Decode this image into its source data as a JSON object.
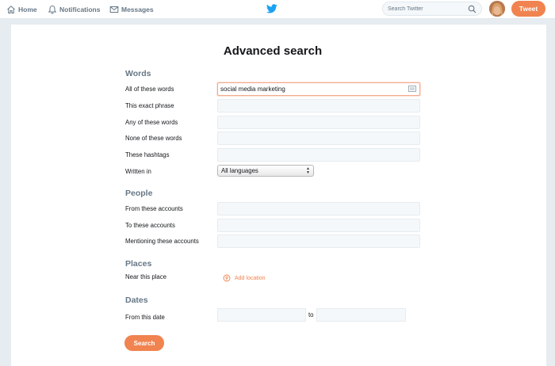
{
  "nav": {
    "home": "Home",
    "notifications": "Notifications",
    "messages": "Messages"
  },
  "search": {
    "placeholder": "Search Twitter"
  },
  "tweet_button": "Tweet",
  "page_title": "Advanced search",
  "words": {
    "heading": "Words",
    "all_label": "All of these words",
    "all_value": "social media marketing",
    "exact_label": "This exact phrase",
    "any_label": "Any of these words",
    "none_label": "None of these words",
    "hashtags_label": "These hashtags",
    "written_in_label": "Written in",
    "language_selected": "All languages"
  },
  "people": {
    "heading": "People",
    "from_label": "From these accounts",
    "to_label": "To these accounts",
    "mentioning_label": "Mentioning these accounts"
  },
  "places": {
    "heading": "Places",
    "near_label": "Near this place",
    "add_location": "Add location"
  },
  "dates": {
    "heading": "Dates",
    "from_label": "From this date",
    "to_label": "to"
  },
  "search_button": "Search",
  "colors": {
    "accent": "#f0834f",
    "twitter_blue": "#1da1f2"
  },
  "icons": [
    "home-icon",
    "bell-icon",
    "envelope-icon",
    "twitter-bird-icon",
    "magnifier-icon",
    "keyboard-icon",
    "location-pin-icon"
  ]
}
